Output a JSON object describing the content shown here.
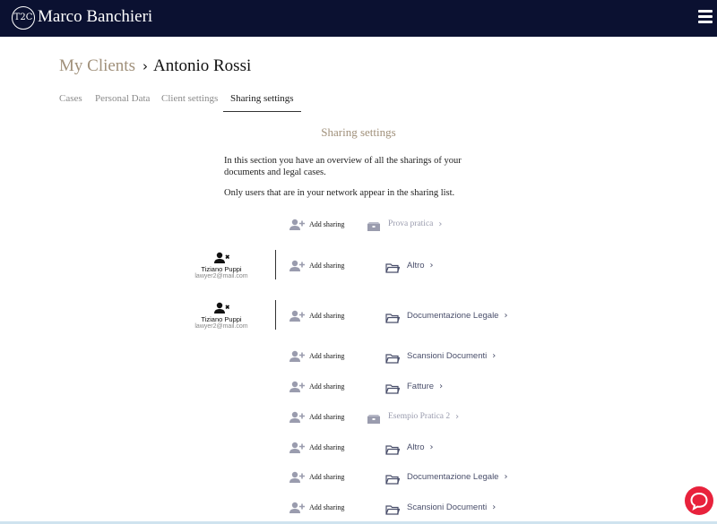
{
  "header": {
    "logo_text": "T2C",
    "title": "Marco Banchieri",
    "menu_icon": "hamburger-icon"
  },
  "breadcrumb": {
    "parent": "My Clients",
    "current": "Antonio Rossi"
  },
  "tabs": [
    "Cases",
    "Personal Data",
    "Client settings",
    "Sharing settings"
  ],
  "active_tab": "Sharing settings",
  "section": {
    "title": "Sharing settings",
    "desc1_line1": "In this section you have an overview of all the sharings of your",
    "desc1_line2": "documents and legal cases.",
    "desc2": "Only users that are in your network appear in the sharing list."
  },
  "add_label": "Add sharing",
  "users": [
    {
      "name": "Tiziano Puppi",
      "email": "lawyer2@mail.com"
    },
    {
      "name": "Tiziano Puppi",
      "email": "lawyer2@mail.com"
    }
  ],
  "rows": [
    {
      "label": "Prova pratica",
      "kind": "case"
    },
    {
      "label": "Altro",
      "kind": "folder"
    },
    {
      "label": "Documentazione Legale",
      "kind": "folder"
    },
    {
      "label": "Scansioni Documenti",
      "kind": "folder"
    },
    {
      "label": "Fatture",
      "kind": "folder"
    },
    {
      "label": "Esempio Pratica 2",
      "kind": "case"
    },
    {
      "label": "Altro",
      "kind": "folder"
    },
    {
      "label": "Documentazione Legale",
      "kind": "folder"
    },
    {
      "label": "Scansioni Documenti",
      "kind": "folder"
    }
  ],
  "colors": {
    "topbar": "#0b1131",
    "accent": "#a0907a",
    "chat": "#e8223c",
    "icon": "#9a9cae"
  }
}
